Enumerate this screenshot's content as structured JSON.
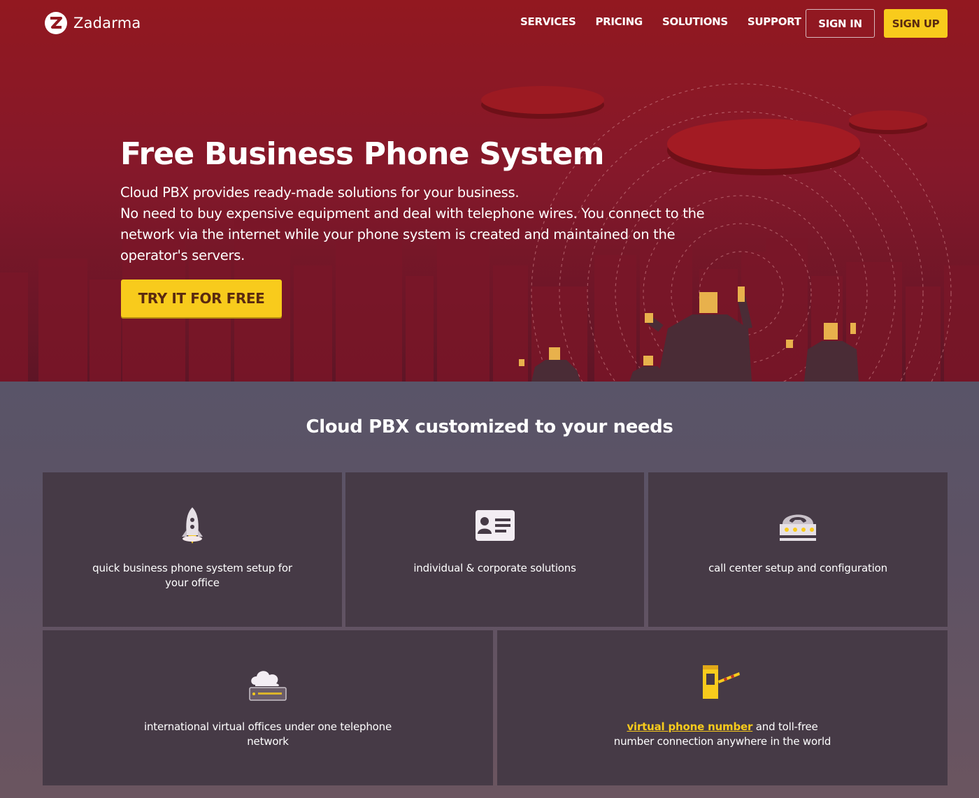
{
  "header": {
    "logo_text": "Zadarma",
    "nav": [
      "SERVICES",
      "PRICING",
      "SOLUTIONS",
      "SUPPORT"
    ],
    "sign_in": "SIGN IN",
    "sign_up": "SIGN UP"
  },
  "hero": {
    "title": "Free Business Phone System",
    "line1": "Cloud PBX provides ready-made solutions for your business.",
    "line2": "No need to buy expensive equipment and deal with telephone wires. You connect to the network via the internet while your phone system is created and maintained on the operator's servers.",
    "cta": "TRY IT FOR FREE"
  },
  "features": {
    "title": "Cloud PBX customized to your needs",
    "items": [
      {
        "icon": "rocket-icon",
        "text": "quick business phone system setup for your office"
      },
      {
        "icon": "id-card-icon",
        "text": "individual & corporate solutions"
      },
      {
        "icon": "office-phone-icon",
        "text": "call center setup and configuration"
      },
      {
        "icon": "cloud-server-icon",
        "text": "international virtual offices under one telephone network"
      },
      {
        "icon": "toll-booth-icon",
        "link": "virtual phone number",
        "text": " and toll-free number connection anywhere in the world"
      }
    ]
  },
  "colors": {
    "hero_red": "#921820",
    "accent_yellow": "#f8cb1c",
    "card_bg": "#463a46"
  }
}
